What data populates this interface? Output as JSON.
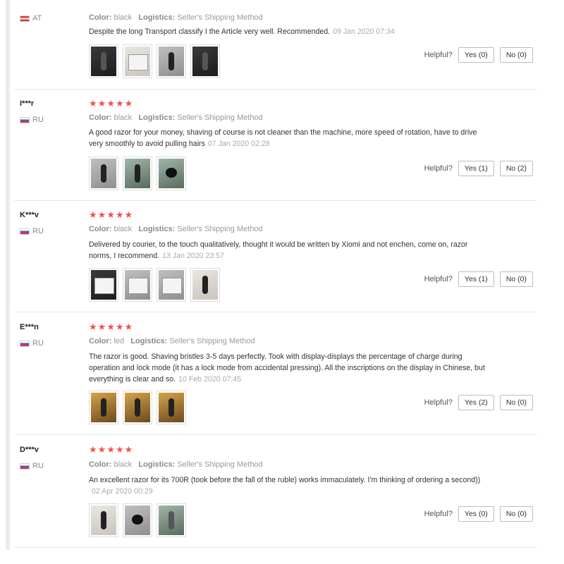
{
  "labels": {
    "color": "Color:",
    "logistics": "Logistics:",
    "helpful": "Helpful?"
  },
  "reviews": [
    {
      "user": "",
      "country": "AT",
      "flag": "at",
      "color": "black",
      "logistics": "Seller's Shipping Method",
      "text": "Despite the long Transport classify I the Article very well. Recommended.",
      "date": "09 Jan 2020 07:34",
      "yes": "Yes (0)",
      "no": "No (0)",
      "photos": [
        "dark-razor-photo",
        "light-box-photo",
        "grey-razor-photo",
        "dark-razor-photo"
      ]
    },
    {
      "user": "I***r",
      "country": "RU",
      "flag": "ru",
      "color": "black",
      "logistics": "Seller's Shipping Method",
      "text": "A good razor for your money, shaving of course is not cleaner than the machine, more speed of rotation, have to drive very smoothly to avoid pulling hairs",
      "date": "07 Jan 2020 02:28",
      "yes": "Yes (1)",
      "no": "No (2)",
      "photos": [
        "grey-razor-photo",
        "mix-razor-photo",
        "mix-head-photo"
      ]
    },
    {
      "user": "K***v",
      "country": "RU",
      "flag": "ru",
      "color": "black",
      "logistics": "Seller's Shipping Method",
      "text": "Delivered by courier, to the touch qualitatively, thought it would be written by Xiomi and not enchen, come on, razor norms, I recommend.",
      "date": "13 Jan 2020 23:57",
      "yes": "Yes (1)",
      "no": "No (0)",
      "photos": [
        "dark-box-photo",
        "grey-box-photo",
        "grey-box-photo",
        "light-razor-photo"
      ]
    },
    {
      "user": "E***n",
      "country": "RU",
      "flag": "ru",
      "color": "led",
      "logistics": "Seller's Shipping Method",
      "text": "The razor is good. Shaving bristles 3-5 days perfectly. Took with display-displays the percentage of charge during operation and lock mode (it has a lock mode from accidental pressing). All the inscriptions on the display in Chinese, but everything is clear and so.",
      "date": "10 Feb 2020 07:45",
      "yes": "Yes (2)",
      "no": "No (0)",
      "photos": [
        "gold-razor-photo",
        "gold-razor-photo",
        "gold-razor-photo"
      ]
    },
    {
      "user": "D***v",
      "country": "RU",
      "flag": "ru",
      "color": "black",
      "logistics": "Seller's Shipping Method",
      "text": "An excellent razor for its 700R (took before the fall of the ruble) works immaculately. I'm thinking of ordering a second))",
      "date": "02 Apr 2020 00:29",
      "yes": "Yes (0)",
      "no": "No (0)",
      "photos": [
        "light-razor-photo",
        "grey-head-photo",
        "mix-razor-photo"
      ]
    }
  ]
}
